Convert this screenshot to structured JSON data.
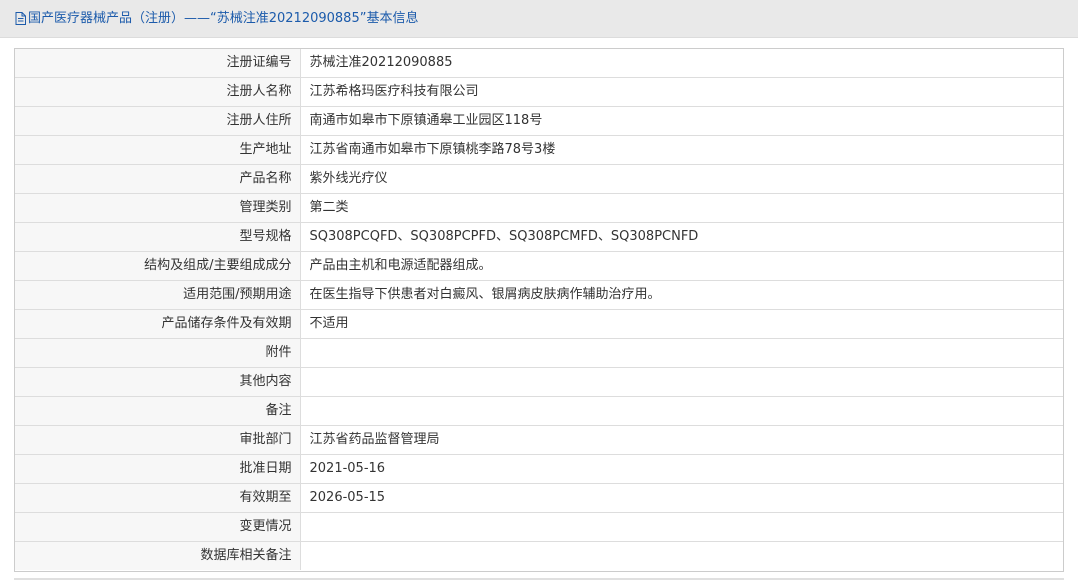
{
  "header": {
    "title": "国产医疗器械产品（注册）——“苏械注准20212090885”基本信息",
    "icon": "document-icon",
    "accent_color": "#1c5bab"
  },
  "rows": [
    {
      "label": "注册证编号",
      "value": "苏械注准20212090885"
    },
    {
      "label": "注册人名称",
      "value": "江苏希格玛医疗科技有限公司"
    },
    {
      "label": "注册人住所",
      "value": "南通市如皋市下原镇通皋工业园区118号"
    },
    {
      "label": "生产地址",
      "value": "江苏省南通市如皋市下原镇桃李路78号3楼"
    },
    {
      "label": "产品名称",
      "value": "紫外线光疗仪"
    },
    {
      "label": "管理类别",
      "value": "第二类"
    },
    {
      "label": "型号规格",
      "value": "SQ308PCQFD、SQ308PCPFD、SQ308PCMFD、SQ308PCNFD"
    },
    {
      "label": "结构及组成/主要组成成分",
      "value": "产品由主机和电源适配器组成。"
    },
    {
      "label": "适用范围/预期用途",
      "value": "在医生指导下供患者对白癜风、银屑病皮肤病作辅助治疗用。"
    },
    {
      "label": "产品储存条件及有效期",
      "value": "不适用"
    },
    {
      "label": "附件",
      "value": ""
    },
    {
      "label": "其他内容",
      "value": ""
    },
    {
      "label": "备注",
      "value": ""
    },
    {
      "label": "审批部门",
      "value": "江苏省药品监督管理局"
    },
    {
      "label": "批准日期",
      "value": "2021-05-16"
    },
    {
      "label": "有效期至",
      "value": "2026-05-15"
    },
    {
      "label": "变更情况",
      "value": ""
    },
    {
      "label": "数据库相关备注",
      "value": ""
    }
  ]
}
